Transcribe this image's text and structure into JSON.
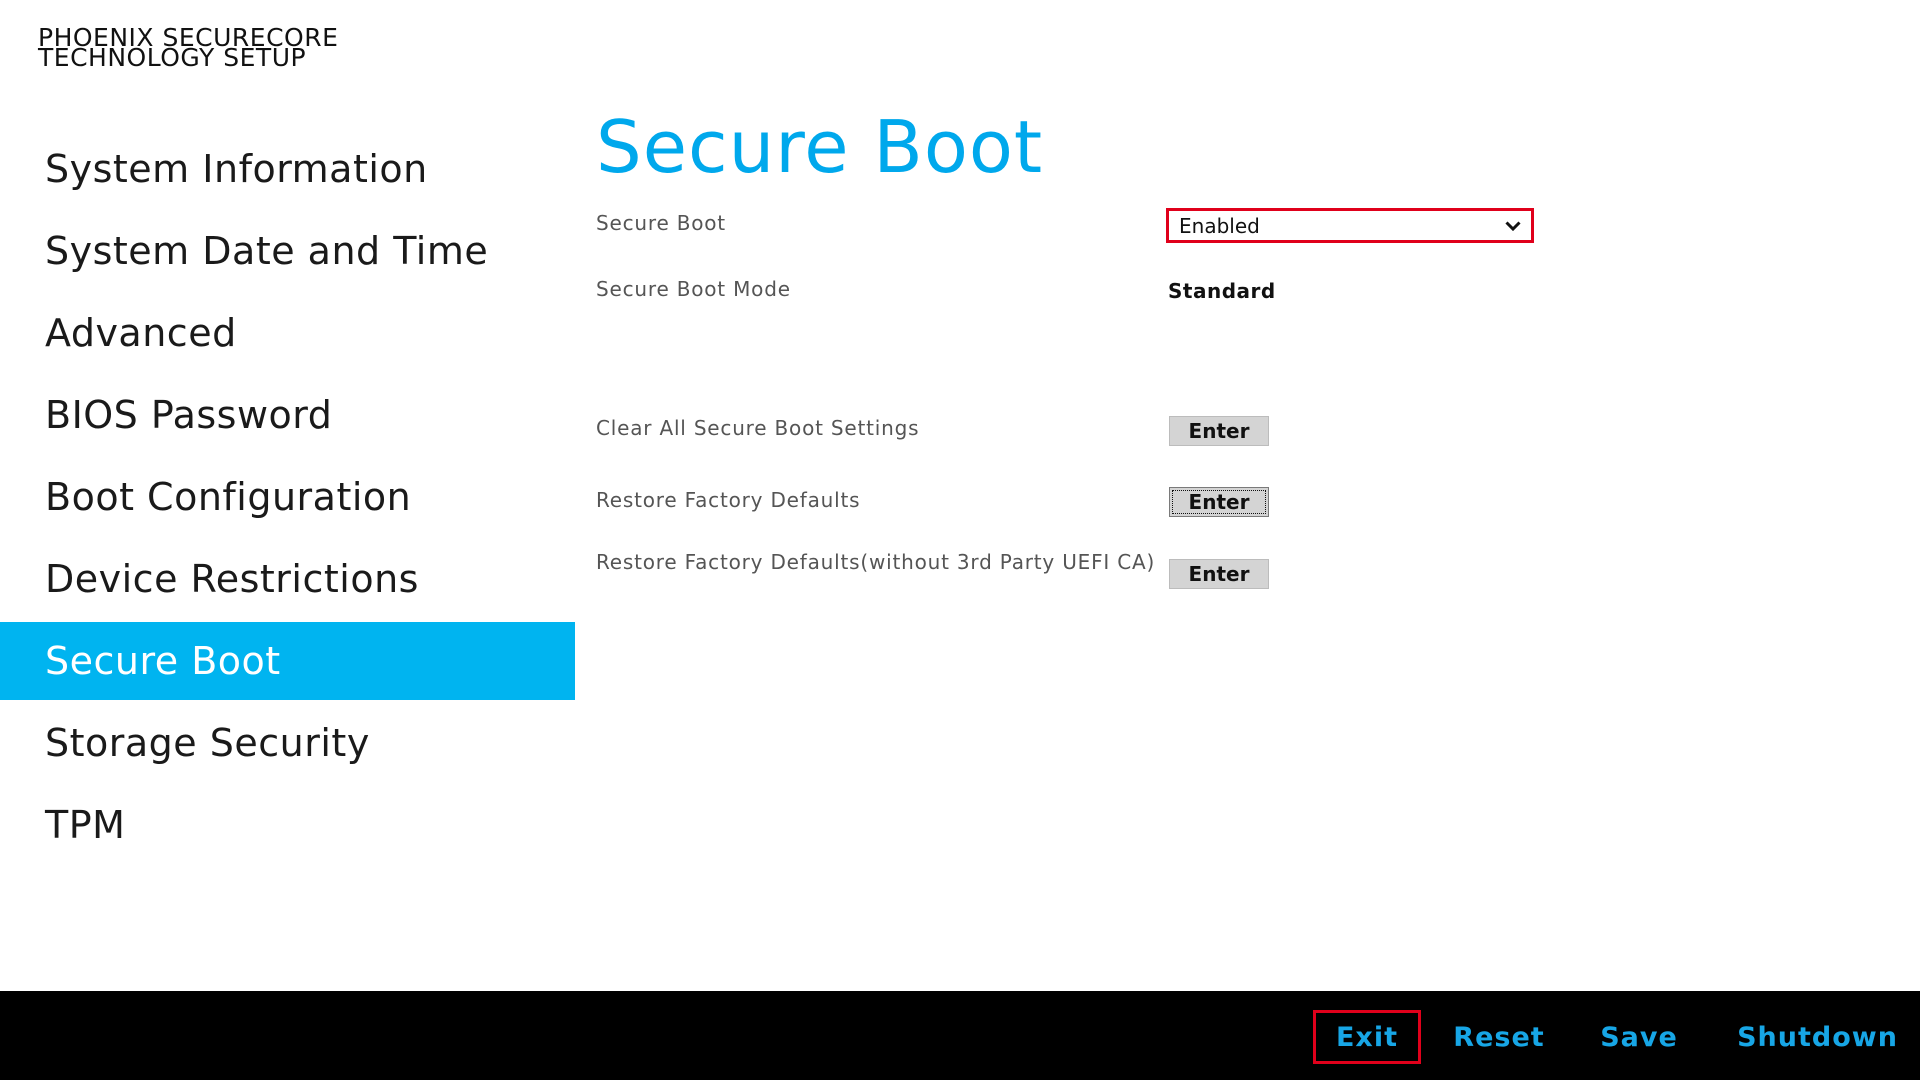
{
  "app": {
    "title_line1": "PHOENIX SECURECORE",
    "title_line2": "TECHNOLOGY SETUP"
  },
  "sidebar": {
    "items": [
      {
        "label": "System Information"
      },
      {
        "label": "System Date and Time"
      },
      {
        "label": "Advanced"
      },
      {
        "label": "BIOS Password"
      },
      {
        "label": "Boot Configuration"
      },
      {
        "label": "Device Restrictions"
      },
      {
        "label": "Secure Boot",
        "active": true
      },
      {
        "label": "Storage Security"
      },
      {
        "label": "TPM"
      }
    ]
  },
  "main": {
    "title": "Secure Boot",
    "secure_boot": {
      "label": "Secure Boot",
      "value": "Enabled"
    },
    "secure_boot_mode": {
      "label": "Secure Boot Mode",
      "value": "Standard"
    },
    "clear_all": {
      "label": "Clear All Secure Boot Settings",
      "button": "Enter"
    },
    "restore_defaults": {
      "label": "Restore Factory Defaults",
      "button": "Enter"
    },
    "restore_defaults_no_3rd": {
      "label": "Restore Factory Defaults(without 3rd Party UEFI CA)",
      "button": "Enter"
    }
  },
  "footer": {
    "exit": "Exit",
    "reset": "Reset",
    "save": "Save",
    "shutdown": "Shutdown"
  },
  "colors": {
    "accent": "#00b4f0",
    "title": "#00a8ec",
    "highlight_border": "#e0001b",
    "footer_bg": "#000000",
    "footer_text": "#17a6e6"
  },
  "icons": {
    "dropdown": "chevron-down-icon"
  }
}
